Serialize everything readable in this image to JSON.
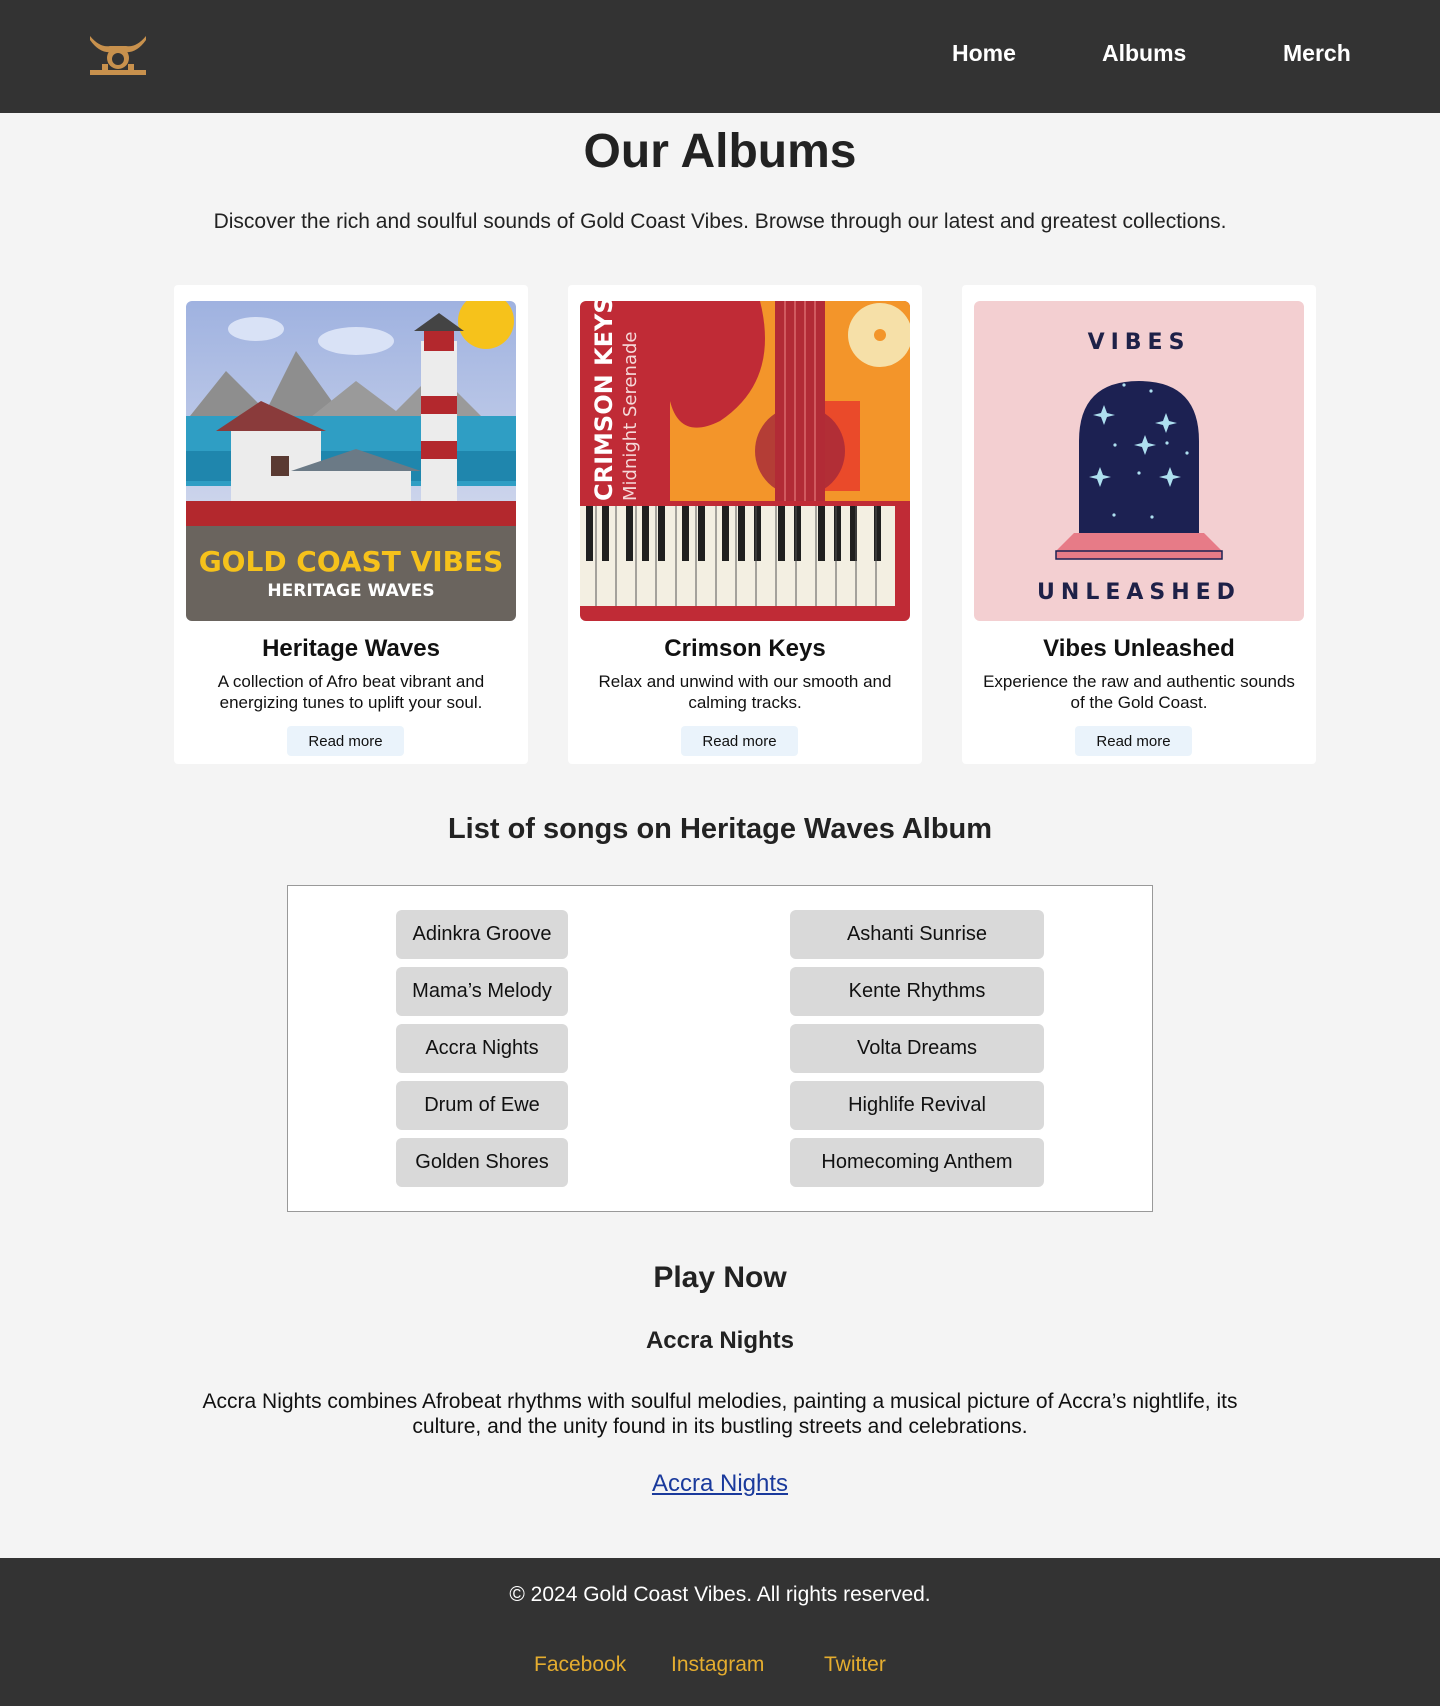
{
  "nav": {
    "links": [
      "Home",
      "Albums",
      "Merch"
    ]
  },
  "page": {
    "title": "Our Albums",
    "intro": "Discover the rich and soulful sounds of Gold Coast Vibes. Browse through our latest and greatest collections."
  },
  "albums": [
    {
      "title": "Heritage Waves",
      "description": "A collection of Afro beat vibrant and energizing tunes to uplift your soul.",
      "button": "Read more",
      "cover_text_main": "GOLD COAST VIBES",
      "cover_text_sub": "HERITAGE WAVES"
    },
    {
      "title": "Crimson Keys",
      "description": "Relax and unwind with our smooth and calming tracks.",
      "button": "Read more",
      "cover_text_main": "CRIMSON KEYS",
      "cover_text_sub": "Midnight Serenade"
    },
    {
      "title": "Vibes Unleashed",
      "description": "Experience the raw and authentic sounds of the Gold Coast.",
      "button": "Read more",
      "cover_text_main": "VIBES",
      "cover_text_sub": "UNLEASHED"
    }
  ],
  "songs": {
    "heading": "List of songs on Heritage Waves Album",
    "left": [
      "Adinkra Groove",
      "Mama’s Melody",
      "Accra Nights",
      "Drum of Ewe",
      "Golden Shores"
    ],
    "right": [
      "Ashanti Sunrise",
      "Kente Rhythms",
      "Volta Dreams",
      "Highlife Revival",
      "Homecoming Anthem"
    ]
  },
  "play": {
    "heading": "Play Now",
    "song_title": "Accra Nights",
    "description": "Accra Nights combines Afrobeat rhythms with soulful melodies, painting a musical picture of Accra’s nightlife, its culture, and the unity found in its bustling streets and celebrations.",
    "link_text": "Accra Nights"
  },
  "footer": {
    "copyright": "© 2024 Gold Coast Vibes. All rights reserved.",
    "social": [
      "Facebook",
      "Instagram",
      "Twitter"
    ]
  },
  "colors": {
    "header_bg": "#333333",
    "page_bg": "#f4f4f4",
    "social_link": "#e5ad2f",
    "logo": "#c8914d",
    "song_pill": "#d9d9d9",
    "button_bg": "#eaf3fb"
  },
  "icons": {
    "logo": "adinkra-logo-icon"
  }
}
